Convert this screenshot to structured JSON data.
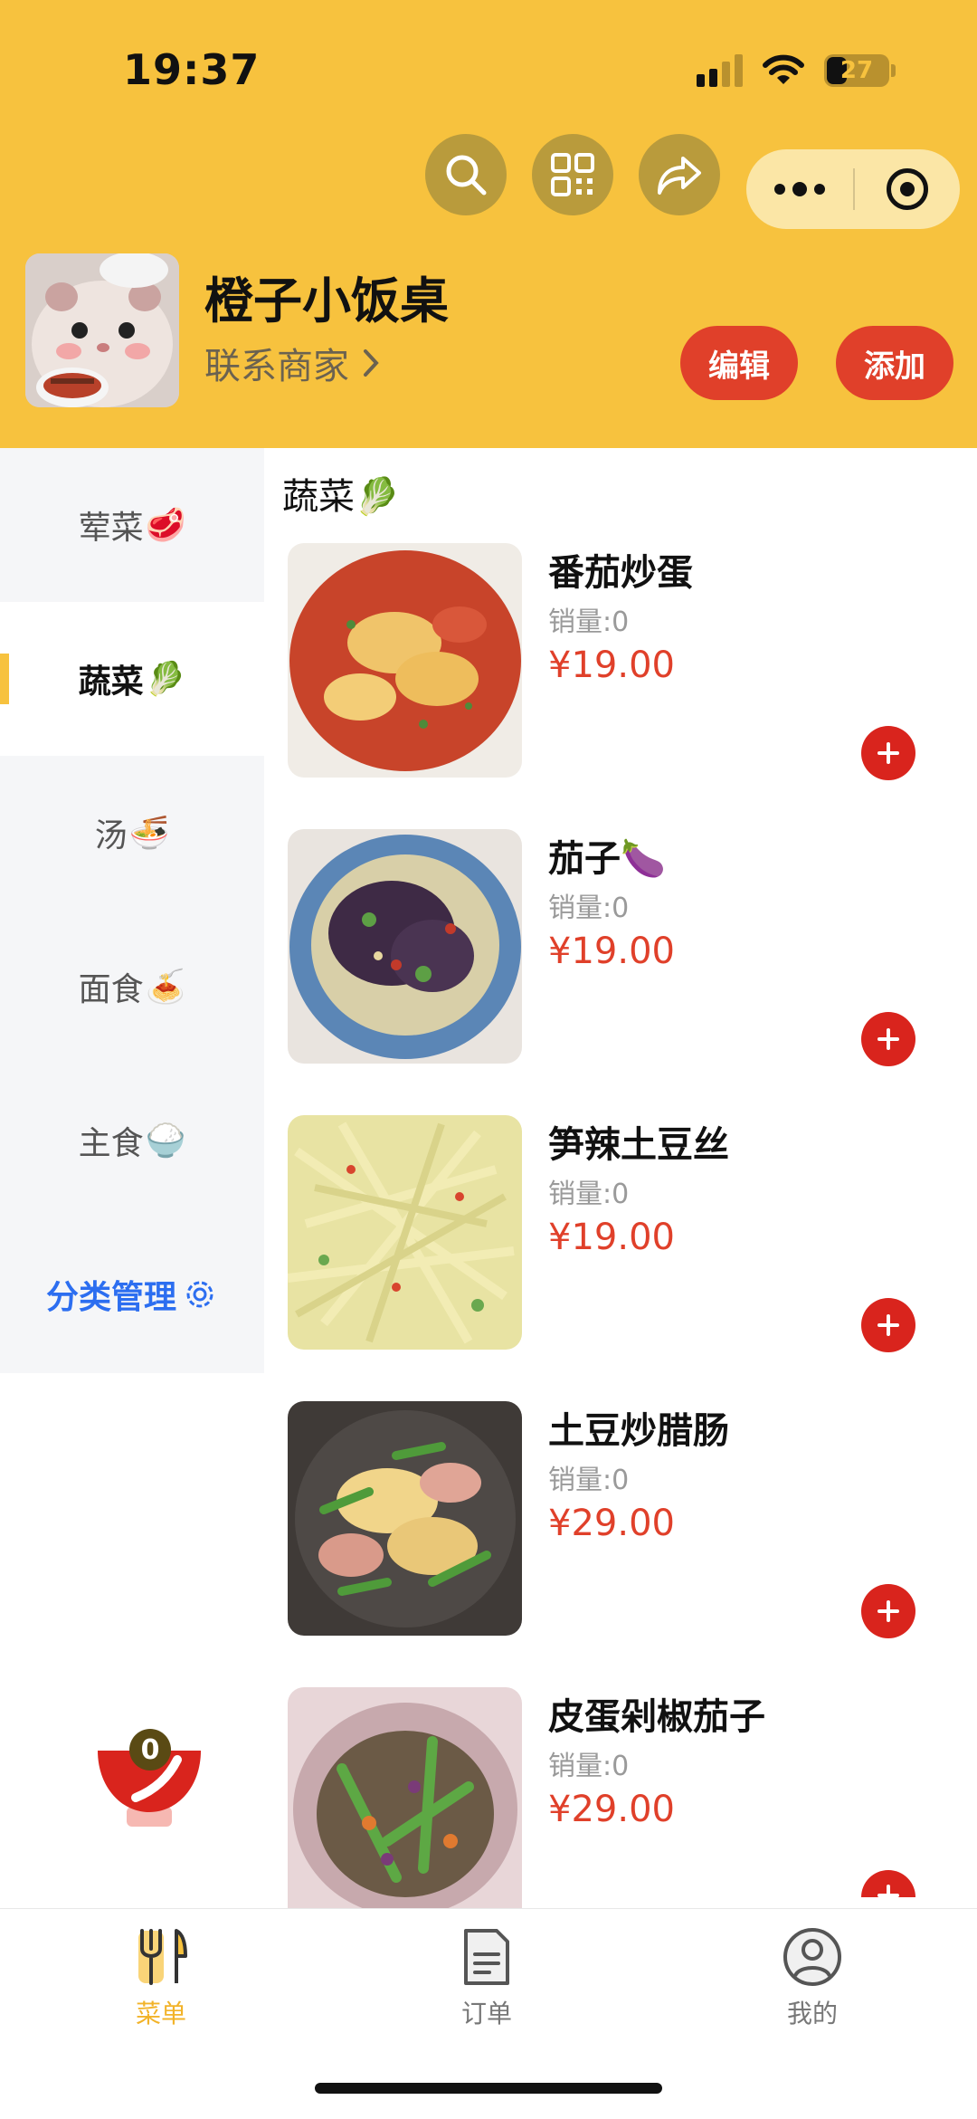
{
  "status_bar": {
    "time": "19:37",
    "battery": "27"
  },
  "shop": {
    "name": "橙子小饭桌",
    "contact": "联系商家",
    "edit_label": "编辑",
    "add_label": "添加"
  },
  "sidebar": {
    "items": [
      {
        "label": "荤菜",
        "emoji": "🥩"
      },
      {
        "label": "蔬菜",
        "emoji": "🥬"
      },
      {
        "label": "汤",
        "emoji": "🍜"
      },
      {
        "label": "面食",
        "emoji": "🍝"
      },
      {
        "label": "主食",
        "emoji": "🍚"
      }
    ],
    "active_index": 1,
    "manage_label": "分类管理"
  },
  "section": {
    "title": "蔬菜",
    "emoji": "🥬"
  },
  "dishes": [
    {
      "name": "番茄炒蛋",
      "sales": "销量:0",
      "price": "¥19.00"
    },
    {
      "name": "茄子🍆",
      "sales": "销量:0",
      "price": "¥19.00"
    },
    {
      "name": "笋辣土豆丝",
      "sales": "销量:0",
      "price": "¥19.00"
    },
    {
      "name": "土豆炒腊肠",
      "sales": "销量:0",
      "price": "¥29.00"
    },
    {
      "name": "皮蛋剁椒茄子",
      "sales": "销量:0",
      "price": "¥29.00"
    }
  ],
  "cart": {
    "count": "0"
  },
  "tabbar": {
    "items": [
      {
        "label": "菜单",
        "icon": "fork-knife-icon"
      },
      {
        "label": "订单",
        "icon": "document-icon"
      },
      {
        "label": "我的",
        "icon": "profile-icon"
      }
    ],
    "active_index": 0
  },
  "colors": {
    "header": "#f7c23e",
    "accent_red": "#e0402a",
    "link_blue": "#2c6ef0",
    "tab_active": "#f2b329"
  }
}
